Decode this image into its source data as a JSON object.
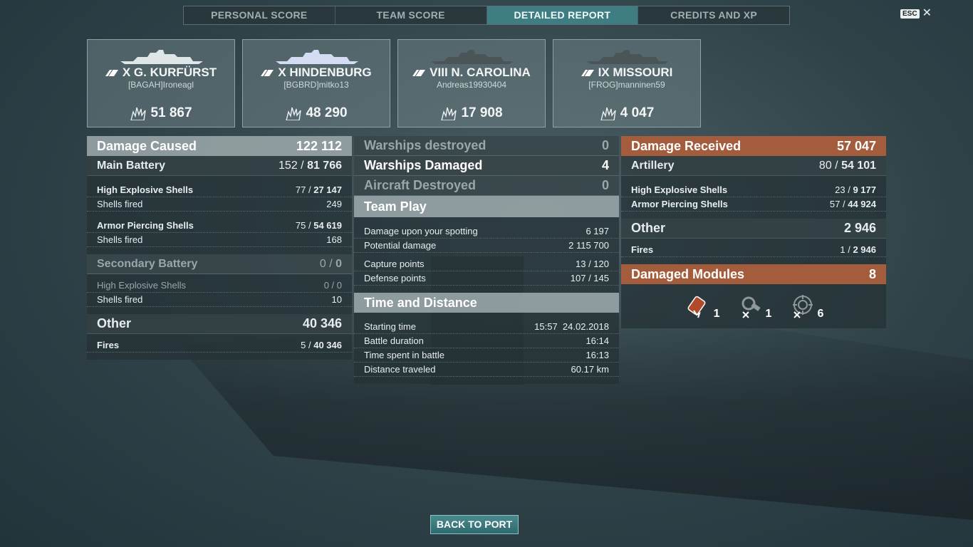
{
  "tabs": [
    "PERSONAL SCORE",
    "TEAM SCORE",
    "DETAILED REPORT",
    "CREDITS AND XP"
  ],
  "active_tab": "DETAILED REPORT",
  "esc_label": "ESC",
  "close_glyph": "✕",
  "ships": [
    {
      "name": "X G. KURFÜRST",
      "player": "[BAGAH]Ironeagl",
      "damage": "51 867"
    },
    {
      "name": "X HINDENBURG",
      "player": "[BGBRD]mitko13",
      "damage": "48 290"
    },
    {
      "name": "VIII N. CAROLINA",
      "player": "Andreas19930404",
      "damage": "17 908"
    },
    {
      "name": "IX MISSOURI",
      "player": "[FROG]manninen59",
      "damage": "4 047"
    }
  ],
  "damage_caused": {
    "title": "Damage Caused",
    "total": "122 112",
    "main_battery": {
      "label": "Main Battery",
      "hits": "152",
      "damage": "81 766"
    },
    "he_shells": {
      "label": "High Explosive Shells",
      "hits": "77",
      "damage": "27 147"
    },
    "he_fired": {
      "label": "Shells fired",
      "value": "249"
    },
    "ap_shells": {
      "label": "Armor Piercing Shells",
      "hits": "75",
      "damage": "54 619"
    },
    "ap_fired": {
      "label": "Shells fired",
      "value": "168"
    },
    "secondary": {
      "label": "Secondary Battery",
      "hits": "0",
      "damage": "0"
    },
    "sec_he": {
      "label": "High Explosive Shells",
      "hits": "0",
      "damage": "0"
    },
    "sec_fired": {
      "label": "Shells fired",
      "value": "10"
    },
    "other": {
      "label": "Other",
      "total": "40 346"
    },
    "fires": {
      "label": "Fires",
      "hits": "5",
      "damage": "40 346"
    }
  },
  "middle": {
    "warships_destroyed": {
      "label": "Warships destroyed",
      "value": "0"
    },
    "warships_damaged": {
      "label": "Warships Damaged",
      "value": "4"
    },
    "aircraft_destroyed": {
      "label": "Aircraft Destroyed",
      "value": "0"
    },
    "team_play": {
      "title": "Team Play",
      "spotting": {
        "label": "Damage upon your spotting",
        "value": "6 197"
      },
      "potential": {
        "label": "Potential damage",
        "value": "2 115 700"
      },
      "capture": {
        "label": "Capture points",
        "value": "13 / 120"
      },
      "defense": {
        "label": "Defense points",
        "value": "107 / 145"
      }
    },
    "time_distance": {
      "title": "Time and Distance",
      "start": {
        "label": "Starting time",
        "value": "15:57  24.02.2018"
      },
      "duration": {
        "label": "Battle duration",
        "value": "16:14"
      },
      "spent": {
        "label": "Time spent in battle",
        "value": "16:13"
      },
      "distance": {
        "label": "Distance traveled",
        "value": "60.17 km"
      }
    }
  },
  "damage_received": {
    "title": "Damage Received",
    "total": "57 047",
    "artillery": {
      "label": "Artillery",
      "hits": "80",
      "damage": "54 101"
    },
    "he_shells": {
      "label": "High Explosive Shells",
      "hits": "23",
      "damage": "9 177"
    },
    "ap_shells": {
      "label": "Armor Piercing Shells",
      "hits": "57",
      "damage": "44 924"
    },
    "other": {
      "label": "Other",
      "total": "2 946"
    },
    "fires": {
      "label": "Fires",
      "hits": "1",
      "damage": "2 946"
    },
    "modules": {
      "label": "Damaged Modules",
      "total": "8",
      "items": [
        {
          "icon": "engine-module-icon",
          "count": "1"
        },
        {
          "icon": "steering-gear-icon",
          "count": "1"
        },
        {
          "icon": "turret-module-icon",
          "count": "6"
        }
      ]
    }
  },
  "back_button": "BACK TO PORT",
  "colors": {
    "active_tab": "#3e7d82",
    "damage_received_header": "#a35d3c"
  }
}
